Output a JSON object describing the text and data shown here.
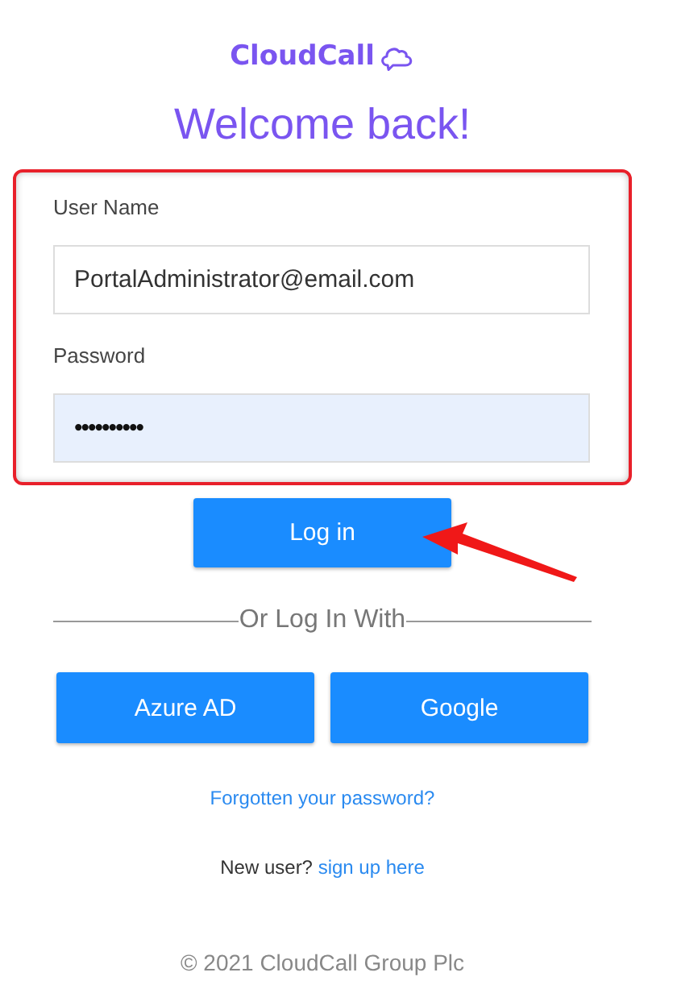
{
  "logo": {
    "text": "CloudCall"
  },
  "heading": "Welcome back!",
  "form": {
    "highlighted": true,
    "fields": [
      {
        "label": "User Name",
        "value": "PortalAdministrator@email.com",
        "autofilled": false
      },
      {
        "label": "Password",
        "value": "••••••••••",
        "autofilled": true
      }
    ]
  },
  "login_button": {
    "label": "Log in",
    "pointed": true
  },
  "divider_text": "Or Log In With",
  "providers": [
    {
      "label": "Azure AD"
    },
    {
      "label": "Google"
    }
  ],
  "forgot_link": "Forgotten your password?",
  "signup": {
    "text": "New user?",
    "link": "sign up here"
  },
  "footer": "© 2021 CloudCall Group Plc"
}
